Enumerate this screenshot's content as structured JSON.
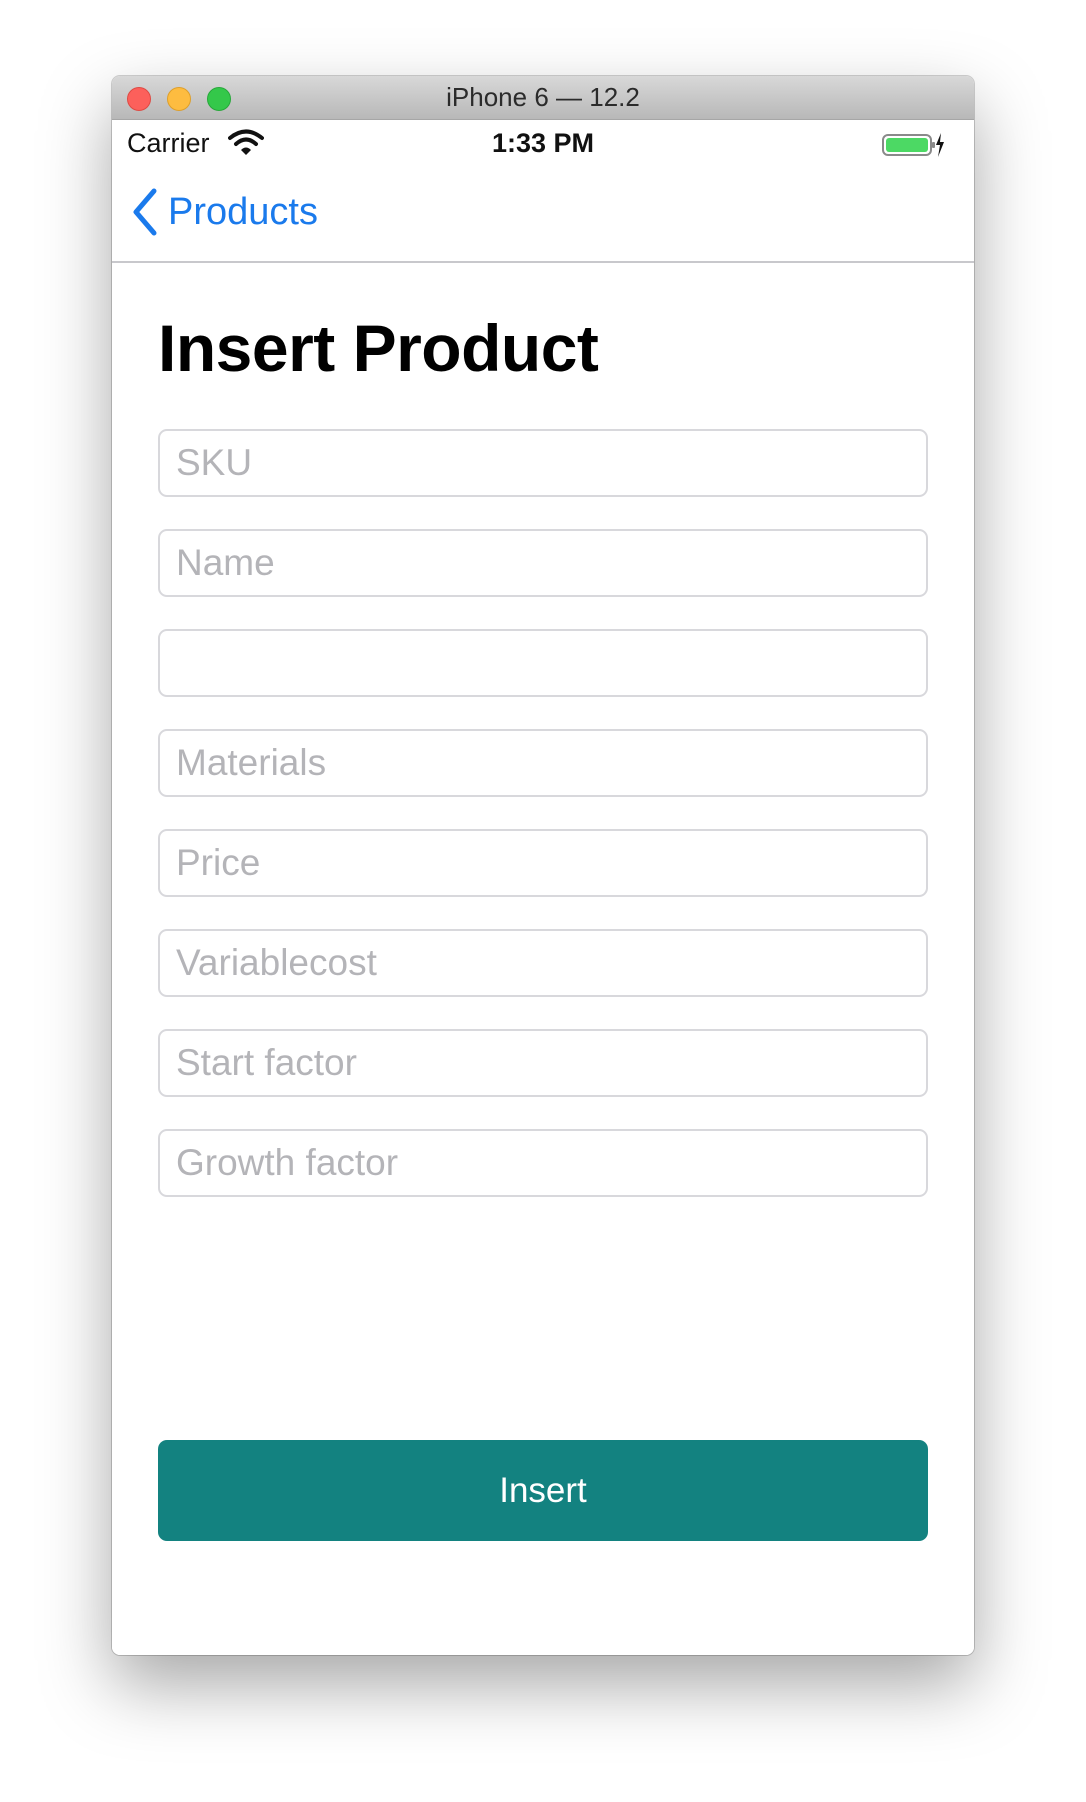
{
  "window": {
    "title": "iPhone 6 — 12.2"
  },
  "status_bar": {
    "carrier": "Carrier",
    "time": "1:33 PM",
    "battery_color": "#4cd964"
  },
  "nav": {
    "back_label": "Products",
    "accent_color": "#1a7aec"
  },
  "page": {
    "title": "Insert Product"
  },
  "form": {
    "fields": [
      {
        "placeholder": "SKU",
        "value": ""
      },
      {
        "placeholder": "Name",
        "value": ""
      },
      {
        "placeholder": "",
        "value": ""
      },
      {
        "placeholder": "Materials",
        "value": ""
      },
      {
        "placeholder": "Price",
        "value": ""
      },
      {
        "placeholder": "Variablecost",
        "value": ""
      },
      {
        "placeholder": "Start factor",
        "value": ""
      },
      {
        "placeholder": "Growth factor",
        "value": ""
      }
    ],
    "submit_label": "Insert",
    "submit_color": "#138280"
  }
}
